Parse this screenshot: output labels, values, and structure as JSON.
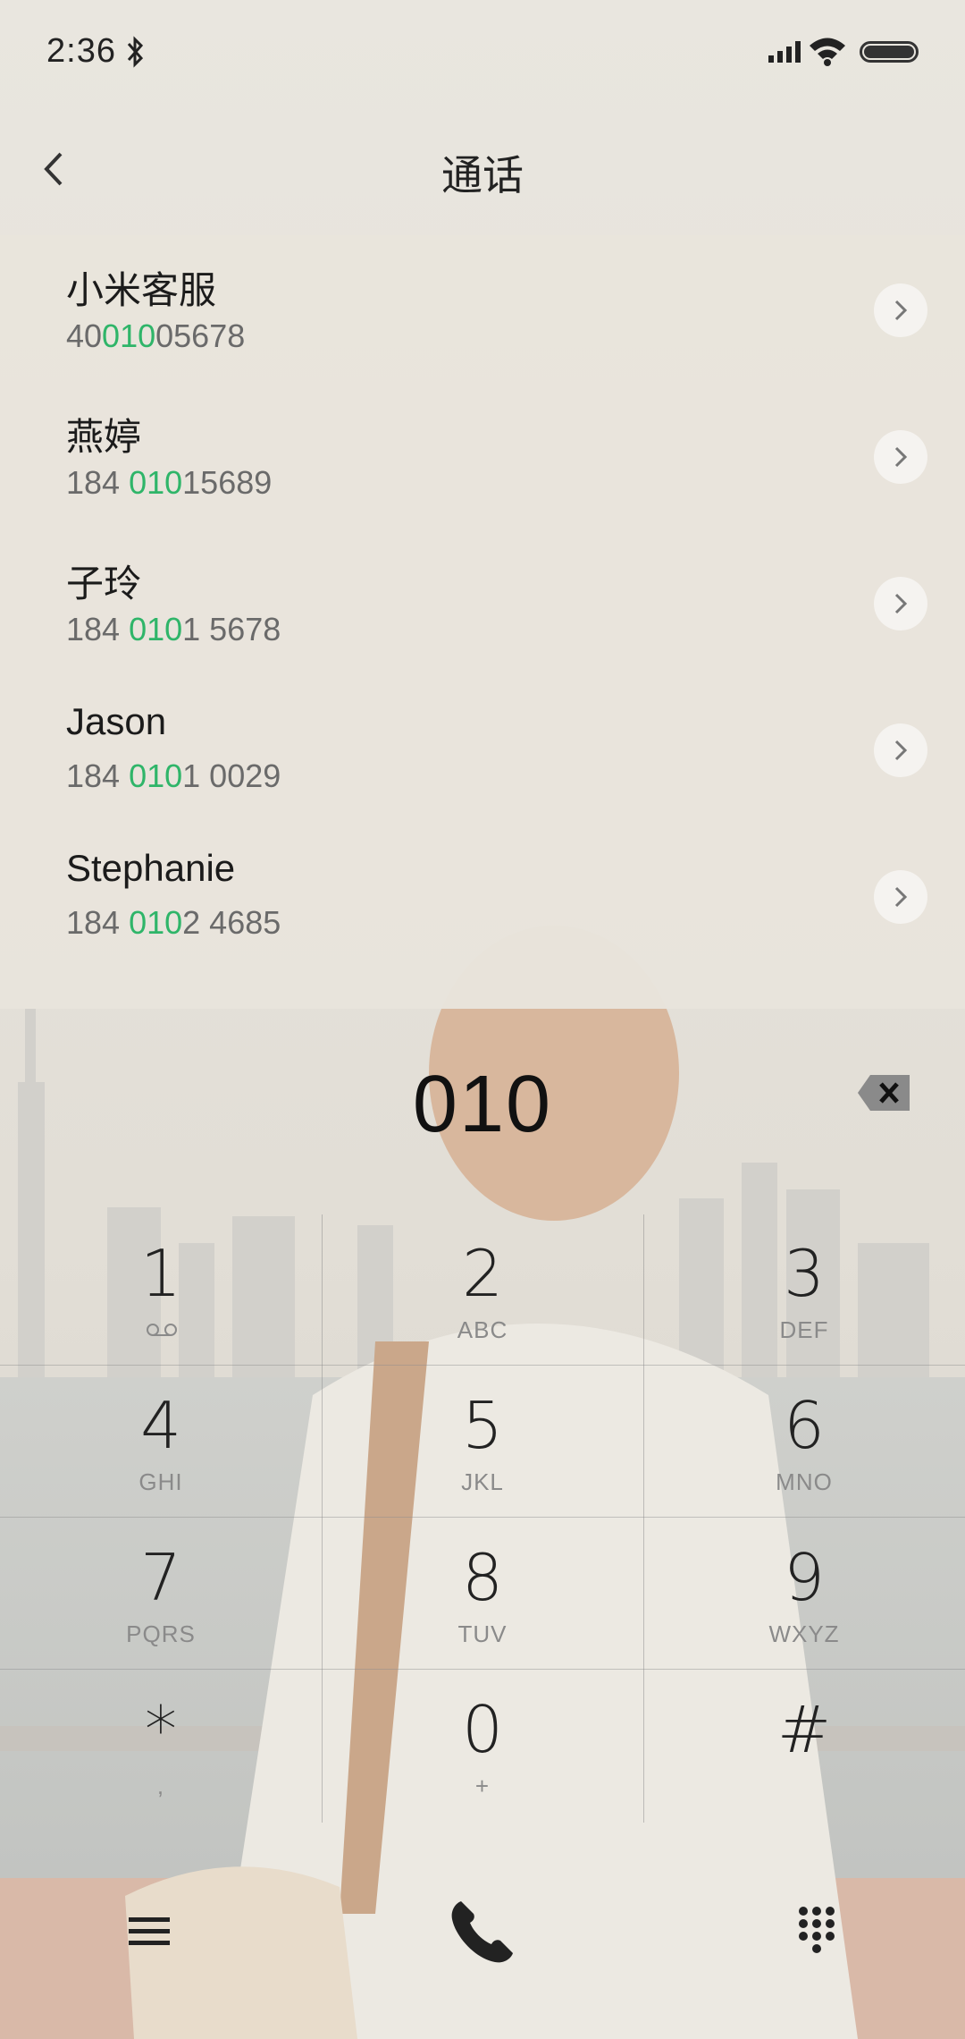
{
  "status_bar": {
    "time": "2:36"
  },
  "header": {
    "title": "通话"
  },
  "contacts": [
    {
      "name": "小米客服",
      "num_pre": "40",
      "num_hl": "010",
      "num_post": "05678"
    },
    {
      "name": "燕婷",
      "num_pre": "184 ",
      "num_hl": "010",
      "num_post": "15689"
    },
    {
      "name": "子玲",
      "num_pre": "184 ",
      "num_hl": "010",
      "num_post": "1 5678"
    },
    {
      "name": "Jason",
      "num_pre": "184 ",
      "num_hl": "010",
      "num_post": "1 0029"
    },
    {
      "name": "Stephanie",
      "num_pre": "184 ",
      "num_hl": "010",
      "num_post": "2 4685"
    }
  ],
  "dialer": {
    "input": "010"
  },
  "keypad": [
    {
      "digit": "1",
      "letters": ""
    },
    {
      "digit": "2",
      "letters": "ABC"
    },
    {
      "digit": "3",
      "letters": "DEF"
    },
    {
      "digit": "4",
      "letters": "GHI"
    },
    {
      "digit": "5",
      "letters": "JKL"
    },
    {
      "digit": "6",
      "letters": "MNO"
    },
    {
      "digit": "7",
      "letters": "PQRS"
    },
    {
      "digit": "8",
      "letters": "TUV"
    },
    {
      "digit": "9",
      "letters": "WXYZ"
    },
    {
      "digit": "*",
      "letters": ","
    },
    {
      "digit": "0",
      "letters": "+"
    },
    {
      "digit": "#",
      "letters": ""
    }
  ],
  "colors": {
    "highlight": "#2fb569",
    "text": "#222222"
  }
}
